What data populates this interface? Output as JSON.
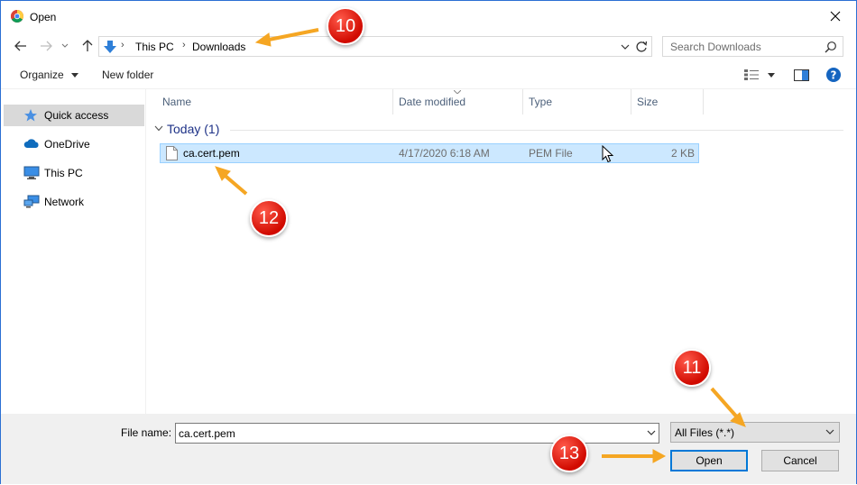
{
  "window": {
    "title": "Open"
  },
  "address": {
    "crumbs": [
      "This PC",
      "Downloads"
    ],
    "search_placeholder": "Search Downloads"
  },
  "toolbar": {
    "organize": "Organize",
    "new_folder": "New folder"
  },
  "navpane": {
    "items": [
      {
        "label": "Quick access"
      },
      {
        "label": "OneDrive"
      },
      {
        "label": "This PC"
      },
      {
        "label": "Network"
      }
    ]
  },
  "columns": {
    "name": "Name",
    "date": "Date modified",
    "type": "Type",
    "size": "Size"
  },
  "group": {
    "label": "Today (1)"
  },
  "file": {
    "name": "ca.cert.pem",
    "date": "4/17/2020 6:18 AM",
    "type": "PEM File",
    "size": "2 KB"
  },
  "bottom": {
    "file_name_label": "File name:",
    "file_name_value": "ca.cert.pem",
    "filter_value": "All Files (*.*)",
    "open_label": "Open",
    "cancel_label": "Cancel"
  },
  "annotations": {
    "a10": "10",
    "a11": "11",
    "a12": "12",
    "a13": "13"
  },
  "colors": {
    "accent": "#0078d7",
    "selection": "#cce8ff",
    "badge": "#d10a00",
    "arrow": "#f5a623"
  }
}
